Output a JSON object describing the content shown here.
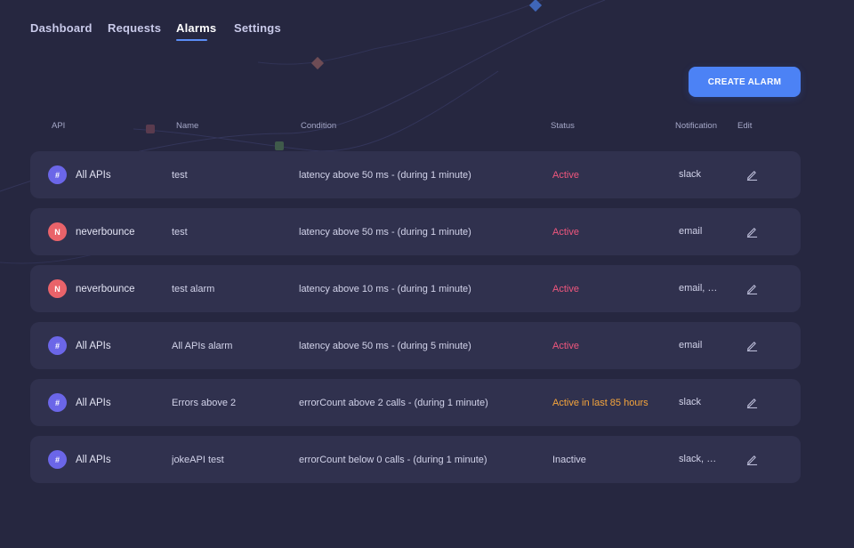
{
  "nav": {
    "tabs": [
      {
        "label": "Dashboard"
      },
      {
        "label": "Requests"
      },
      {
        "label": "Alarms"
      },
      {
        "label": "Settings"
      }
    ],
    "active_tab": "Alarms"
  },
  "toolbar": {
    "create_label": "CREATE ALARM"
  },
  "table": {
    "headers": {
      "api": "API",
      "name": "Name",
      "condition": "Condition",
      "status": "Status",
      "notification": "Notification",
      "edit": "Edit"
    },
    "rows": [
      {
        "api_badge": "#",
        "api": "All APIs",
        "name": "test",
        "condition": "latency above 50 ms - (during 1 minute)",
        "status": "Active",
        "notification": "slack"
      },
      {
        "api_badge": "N",
        "api": "neverbounce",
        "name": "test",
        "condition": "latency above 50 ms - (during 1 minute)",
        "status": "Active",
        "notification": "email"
      },
      {
        "api_badge": "N",
        "api": "neverbounce",
        "name": "test alarm",
        "condition": "latency above 10 ms - (during 1 minute)",
        "status": "Active",
        "notification": "email, p..."
      },
      {
        "api_badge": "#",
        "api": "All APIs",
        "name": "All APIs alarm",
        "condition": "latency above 50 ms - (during 5 minute)",
        "status": "Active",
        "notification": "email"
      },
      {
        "api_badge": "#",
        "api": "All APIs",
        "name": "Errors above 2",
        "condition": "errorCount above 2 calls - (during 1 minute)",
        "status": "Active in last 85 hours",
        "notification": "slack"
      },
      {
        "api_badge": "#",
        "api": "All APIs",
        "name": "jokeAPI test",
        "condition": "errorCount below 0 calls - (during 1 minute)",
        "status": "Inactive",
        "notification": "slack, e..."
      }
    ]
  },
  "icons": {
    "edit": "pencil-icon"
  },
  "colors": {
    "background": "#262740",
    "row_background": "#30314e",
    "accent": "#4c82f5",
    "status_active": "#f0577e",
    "status_recent": "#f5a53c",
    "status_inactive": "#d2d3ea",
    "badge_all_apis": "#6b66e8",
    "badge_neverbounce": "#e9636a"
  }
}
